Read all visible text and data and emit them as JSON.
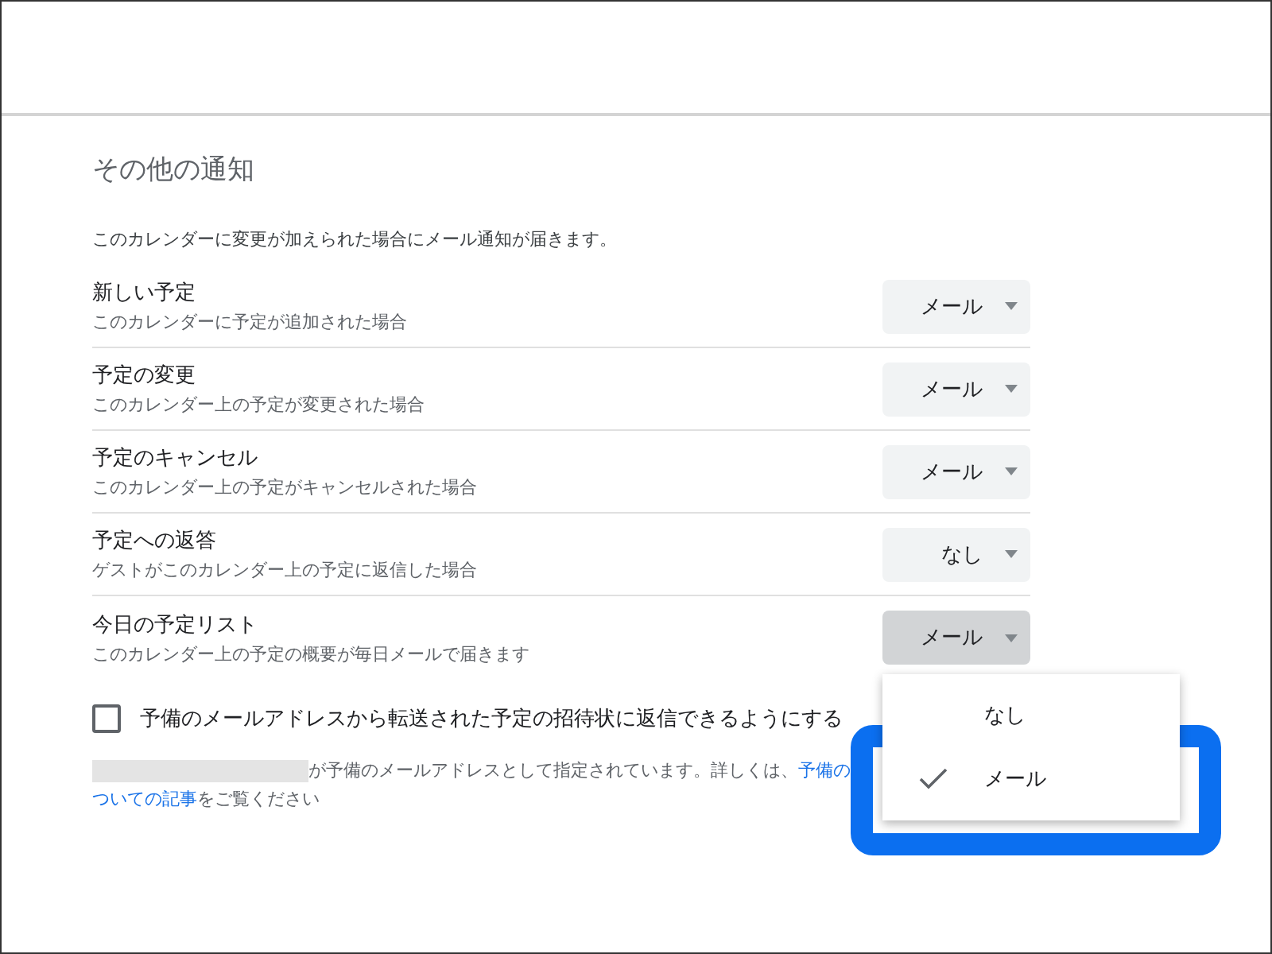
{
  "section": {
    "title": "その他の通知",
    "description": "このカレンダーに変更が加えられた場合にメール通知が届きます。"
  },
  "rows": [
    {
      "title": "新しい予定",
      "subtitle": "このカレンダーに予定が追加された場合",
      "value": "メール",
      "open": false
    },
    {
      "title": "予定の変更",
      "subtitle": "このカレンダー上の予定が変更された場合",
      "value": "メール",
      "open": false
    },
    {
      "title": "予定のキャンセル",
      "subtitle": "このカレンダー上の予定がキャンセルされた場合",
      "value": "メール",
      "open": false
    },
    {
      "title": "予定への返答",
      "subtitle": "ゲストがこのカレンダー上の予定に返信した場合",
      "value": "なし",
      "open": false
    },
    {
      "title": "今日の予定リスト",
      "subtitle": "このカレンダー上の予定の概要が毎日メールで届きます",
      "value": "メール",
      "open": true,
      "menu": [
        {
          "label": "なし",
          "selected": false,
          "highlighted": false
        },
        {
          "label": "メール",
          "selected": true,
          "highlighted": true
        }
      ]
    }
  ],
  "checkbox": {
    "label": "予備のメールアドレスから転送された予定の招待状に返信できるようにする",
    "checked": false
  },
  "info": {
    "redacted": true,
    "line1_text": "が予備のメールアドレスとして指定されています。詳しくは、",
    "line1_link": "予備の",
    "line2_link": "ついての記事",
    "line2_text": "をご覧ください"
  }
}
